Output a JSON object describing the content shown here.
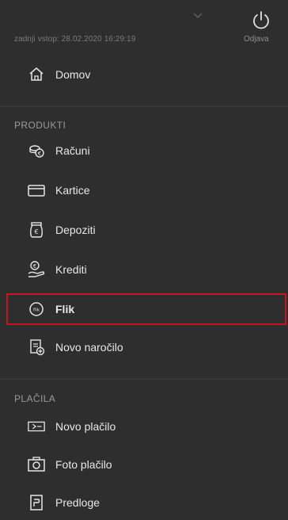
{
  "header": {
    "last_login": "zadnji vstop: 28.02.2020 16:29:19",
    "logout_label": "Odjava",
    "power_icon": "power-icon",
    "chevron_icon": "chevron-down-icon"
  },
  "menu": {
    "home": {
      "label": "Domov",
      "icon": "home-icon"
    },
    "products_title": "PRODUKTI",
    "products": [
      {
        "label": "Računi",
        "icon": "accounts-icon"
      },
      {
        "label": "Kartice",
        "icon": "card-icon"
      },
      {
        "label": "Depoziti",
        "icon": "deposit-icon"
      },
      {
        "label": "Krediti",
        "icon": "loan-icon"
      },
      {
        "label": "Flik",
        "icon": "flik-icon",
        "highlighted": true
      },
      {
        "label": "Novo naročilo",
        "icon": "new-order-icon"
      }
    ],
    "payments_title": "PLAČILA",
    "payments": [
      {
        "label": "Novo plačilo",
        "icon": "new-payment-icon"
      },
      {
        "label": "Foto plačilo",
        "icon": "camera-icon"
      },
      {
        "label": "Predloge",
        "icon": "templates-icon"
      }
    ]
  },
  "colors": {
    "background": "#2e2e2e",
    "text": "#e8e8e8",
    "muted": "#8c8c8c",
    "highlight_border": "#c4161c"
  }
}
